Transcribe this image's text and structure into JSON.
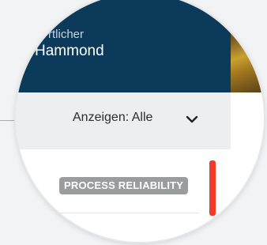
{
  "header": {
    "role_text": "rtlicher",
    "name_text": "Hammond"
  },
  "filter": {
    "label": "Anzeigen: Alle"
  },
  "card": {
    "tag": "PROCESS RELIABILITY"
  },
  "colors": {
    "header_bg": "#0c3a5b",
    "filter_bg": "#eceef0",
    "tag_bg": "#9a9c9f",
    "accent_red": "#f23a2b"
  },
  "icons": {
    "dropdown": "chevron-down-icon"
  }
}
